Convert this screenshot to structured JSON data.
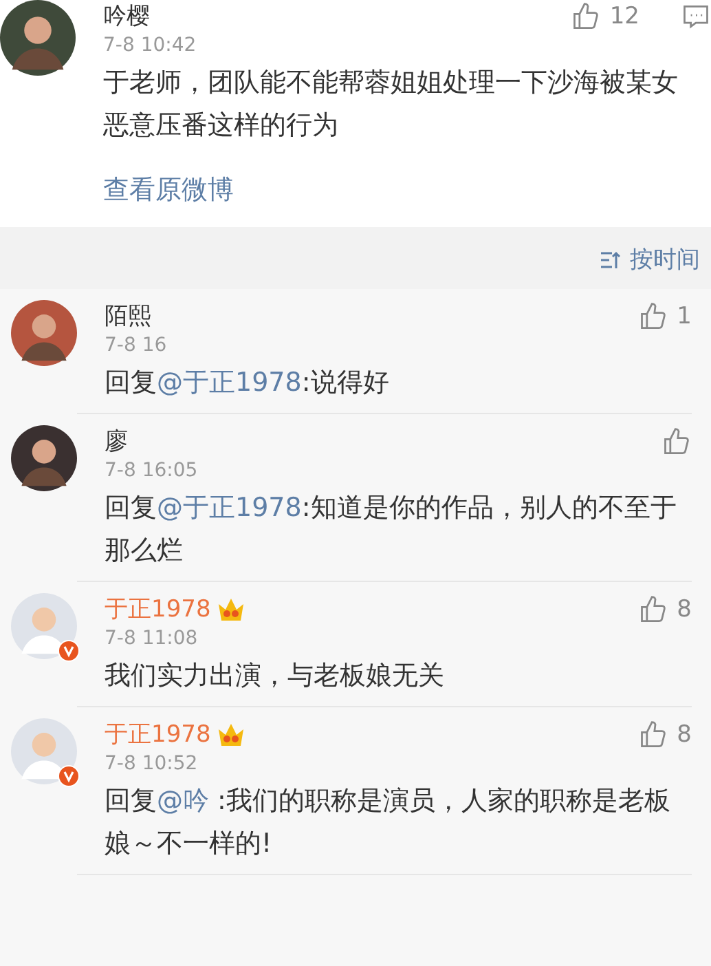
{
  "post": {
    "author": "吟樱",
    "time": "7-8 10:42",
    "likes": "12",
    "text": "于老师，团队能不能帮蓉姐姐处理一下沙海被某女恶意压番这样的行为",
    "link": "查看原微博"
  },
  "sort": {
    "label": "按时间"
  },
  "replies": [
    {
      "author": "陌熙",
      "vip": false,
      "verified": false,
      "time": "7-8 16",
      "likes": "1",
      "prefix": "回复",
      "mention": "@于正1978",
      "text": ":说得好"
    },
    {
      "author": "廖",
      "vip": false,
      "verified": false,
      "time": "7-8 16:05",
      "prefix": "回复",
      "mention": "@于正1978",
      "text": ":知道是你的作品，别人的不至于那么烂"
    },
    {
      "author": "于正1978",
      "vip": true,
      "verified": true,
      "time": "7-8 11:08",
      "likes": "8",
      "text": "我们实力出演，与老板娘无关"
    },
    {
      "author": "于正1978",
      "vip": true,
      "verified": true,
      "time": "7-8 10:52",
      "likes": "8",
      "prefix": "回复",
      "mention": "@吟",
      "text": ":我们的职称是演员，人家的职称是老板娘～不一样的!"
    }
  ]
}
